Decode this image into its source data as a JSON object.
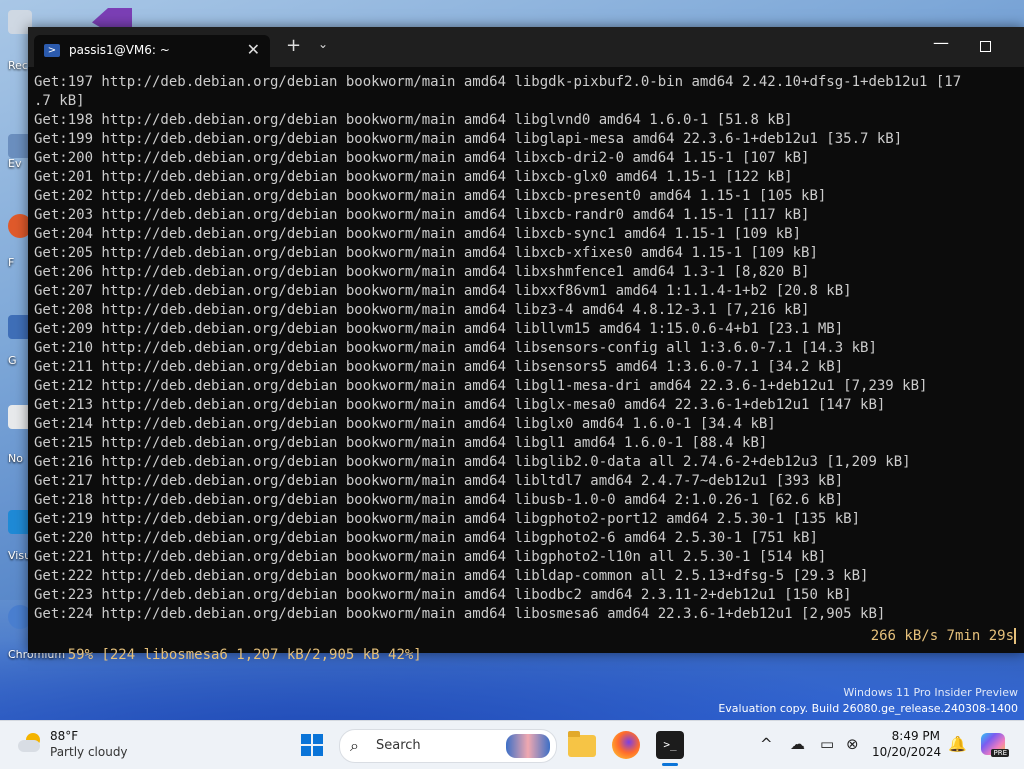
{
  "desktop": {
    "icons": [
      {
        "label": "Rec"
      },
      {
        "label": "Ev"
      },
      {
        "label": "F"
      },
      {
        "label": "G"
      },
      {
        "label": "No"
      },
      {
        "label": "Visu"
      },
      {
        "label": "Chromium"
      }
    ],
    "watermark": {
      "line1": "Windows 11 Pro Insider Preview",
      "line2": "Evaluation copy. Build 26080.ge_release.240308-1400"
    }
  },
  "terminal": {
    "tab_title": "passis1@VM6: ~",
    "close_glyph": "✕",
    "new_tab_glyph": "+",
    "dropdown_glyph": "⌄",
    "minimize_glyph": "—",
    "lines": [
      "Get:197 http://deb.debian.org/debian bookworm/main amd64 libgdk-pixbuf2.0-bin amd64 2.42.10+dfsg-1+deb12u1 [17",
      ".7 kB]",
      "Get:198 http://deb.debian.org/debian bookworm/main amd64 libglvnd0 amd64 1.6.0-1 [51.8 kB]",
      "Get:199 http://deb.debian.org/debian bookworm/main amd64 libglapi-mesa amd64 22.3.6-1+deb12u1 [35.7 kB]",
      "Get:200 http://deb.debian.org/debian bookworm/main amd64 libxcb-dri2-0 amd64 1.15-1 [107 kB]",
      "Get:201 http://deb.debian.org/debian bookworm/main amd64 libxcb-glx0 amd64 1.15-1 [122 kB]",
      "Get:202 http://deb.debian.org/debian bookworm/main amd64 libxcb-present0 amd64 1.15-1 [105 kB]",
      "Get:203 http://deb.debian.org/debian bookworm/main amd64 libxcb-randr0 amd64 1.15-1 [117 kB]",
      "Get:204 http://deb.debian.org/debian bookworm/main amd64 libxcb-sync1 amd64 1.15-1 [109 kB]",
      "Get:205 http://deb.debian.org/debian bookworm/main amd64 libxcb-xfixes0 amd64 1.15-1 [109 kB]",
      "Get:206 http://deb.debian.org/debian bookworm/main amd64 libxshmfence1 amd64 1.3-1 [8,820 B]",
      "Get:207 http://deb.debian.org/debian bookworm/main amd64 libxxf86vm1 amd64 1:1.1.4-1+b2 [20.8 kB]",
      "Get:208 http://deb.debian.org/debian bookworm/main amd64 libz3-4 amd64 4.8.12-3.1 [7,216 kB]",
      "Get:209 http://deb.debian.org/debian bookworm/main amd64 libllvm15 amd64 1:15.0.6-4+b1 [23.1 MB]",
      "Get:210 http://deb.debian.org/debian bookworm/main amd64 libsensors-config all 1:3.6.0-7.1 [14.3 kB]",
      "Get:211 http://deb.debian.org/debian bookworm/main amd64 libsensors5 amd64 1:3.6.0-7.1 [34.2 kB]",
      "Get:212 http://deb.debian.org/debian bookworm/main amd64 libgl1-mesa-dri amd64 22.3.6-1+deb12u1 [7,239 kB]",
      "Get:213 http://deb.debian.org/debian bookworm/main amd64 libglx-mesa0 amd64 22.3.6-1+deb12u1 [147 kB]",
      "Get:214 http://deb.debian.org/debian bookworm/main amd64 libglx0 amd64 1.6.0-1 [34.4 kB]",
      "Get:215 http://deb.debian.org/debian bookworm/main amd64 libgl1 amd64 1.6.0-1 [88.4 kB]",
      "Get:216 http://deb.debian.org/debian bookworm/main amd64 libglib2.0-data all 2.74.6-2+deb12u3 [1,209 kB]",
      "Get:217 http://deb.debian.org/debian bookworm/main amd64 libltdl7 amd64 2.4.7-7~deb12u1 [393 kB]",
      "Get:218 http://deb.debian.org/debian bookworm/main amd64 libusb-1.0-0 amd64 2:1.0.26-1 [62.6 kB]",
      "Get:219 http://deb.debian.org/debian bookworm/main amd64 libgphoto2-port12 amd64 2.5.30-1 [135 kB]",
      "Get:220 http://deb.debian.org/debian bookworm/main amd64 libgphoto2-6 amd64 2.5.30-1 [751 kB]",
      "Get:221 http://deb.debian.org/debian bookworm/main amd64 libgphoto2-l10n all 2.5.30-1 [514 kB]",
      "Get:222 http://deb.debian.org/debian bookworm/main amd64 libldap-common all 2.5.13+dfsg-5 [29.3 kB]",
      "Get:223 http://deb.debian.org/debian bookworm/main amd64 libodbc2 amd64 2.3.11-2+deb12u1 [150 kB]",
      "Get:224 http://deb.debian.org/debian bookworm/main amd64 libosmesa6 amd64 22.3.6-1+deb12u1 [2,905 kB]"
    ],
    "status_left": "59% [224 libosmesa6 1,207 kB/2,905 kB 42%]",
    "status_right": "266 kB/s 7min 29s",
    "status_color": "#e5c07b"
  },
  "taskbar": {
    "weather_temp": "88°F",
    "weather_desc": "Partly cloudy",
    "search_icon_glyph": "⌕",
    "search_label": "Search",
    "terminal_glyph": ">_",
    "tray_chevron": "^",
    "clock_time": "8:49 PM",
    "clock_date": "10/20/2024",
    "copilot_badge": "PRE",
    "accent": "#0a74d8"
  }
}
